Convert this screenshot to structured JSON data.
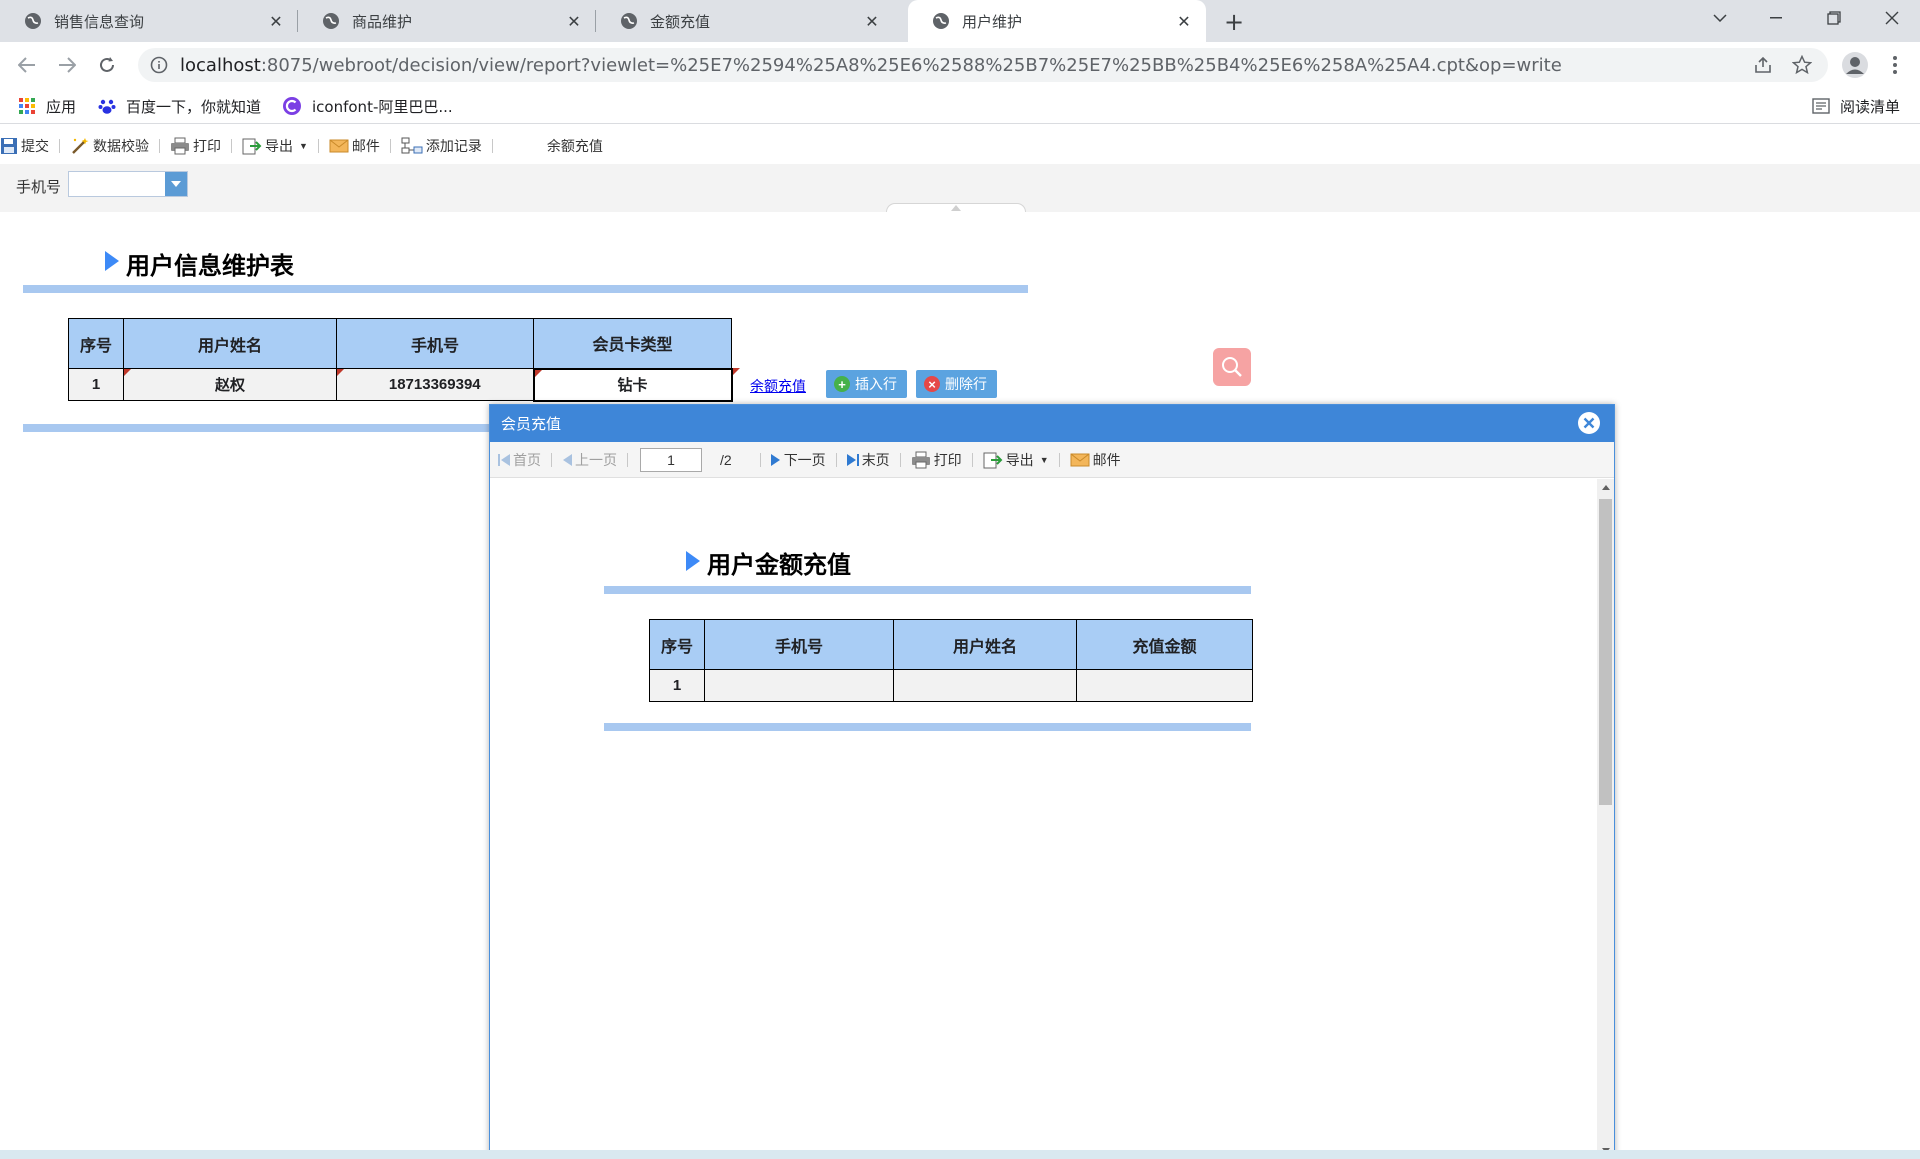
{
  "browser": {
    "tabs": [
      {
        "title": "销售信息查询",
        "active": false
      },
      {
        "title": "商品维护",
        "active": false
      },
      {
        "title": "金额充值",
        "active": false
      },
      {
        "title": "用户维护",
        "active": true
      }
    ],
    "url_host": "localhost",
    "url_rest": ":8075/webroot/decision/view/report?viewlet=%25E7%2594%25A8%25E6%2588%25B7%25E7%25BB%25B4%25E6%258A%25A4.cpt&op=write",
    "bookmarks": {
      "apps": "应用",
      "baidu": "百度一下，你就知道",
      "iconfont": "iconfont-阿里巴巴...",
      "reading_list": "阅读清单"
    }
  },
  "report_toolbar": {
    "submit": "提交",
    "validate": "数据校验",
    "print": "打印",
    "export": "导出",
    "email": "邮件",
    "add_record": "添加记录",
    "balance_recharge": "余额充值"
  },
  "params": {
    "phone_label": "手机号",
    "phone_value": ""
  },
  "main_report": {
    "title": "用户信息维护表",
    "headers": [
      "序号",
      "用户姓名",
      "手机号",
      "会员卡类型"
    ],
    "rows": [
      {
        "seq": "1",
        "name": "赵权",
        "phone": "18713369394",
        "card": "钻卡"
      }
    ],
    "link_recharge": "余额充值",
    "insert_row": "插入行",
    "delete_row": "删除行"
  },
  "dialog": {
    "title": "会员充值",
    "toolbar": {
      "first": "首页",
      "prev": "上一页",
      "page": "1",
      "total": "/2",
      "next": "下一页",
      "last": "末页",
      "print": "打印",
      "export": "导出",
      "email": "邮件"
    },
    "report_title": "用户金额充值",
    "headers": [
      "序号",
      "手机号",
      "用户姓名",
      "充值金额"
    ],
    "rows": [
      {
        "seq": "1",
        "phone": "",
        "name": "",
        "amount": ""
      }
    ]
  },
  "colors": {
    "header_cell": "#a9cdf5",
    "title_rule": "#a8c8f0",
    "dialog_header": "#3e86d8",
    "row_button": "#5ba3e0",
    "search_button": "#f6a3a3"
  }
}
